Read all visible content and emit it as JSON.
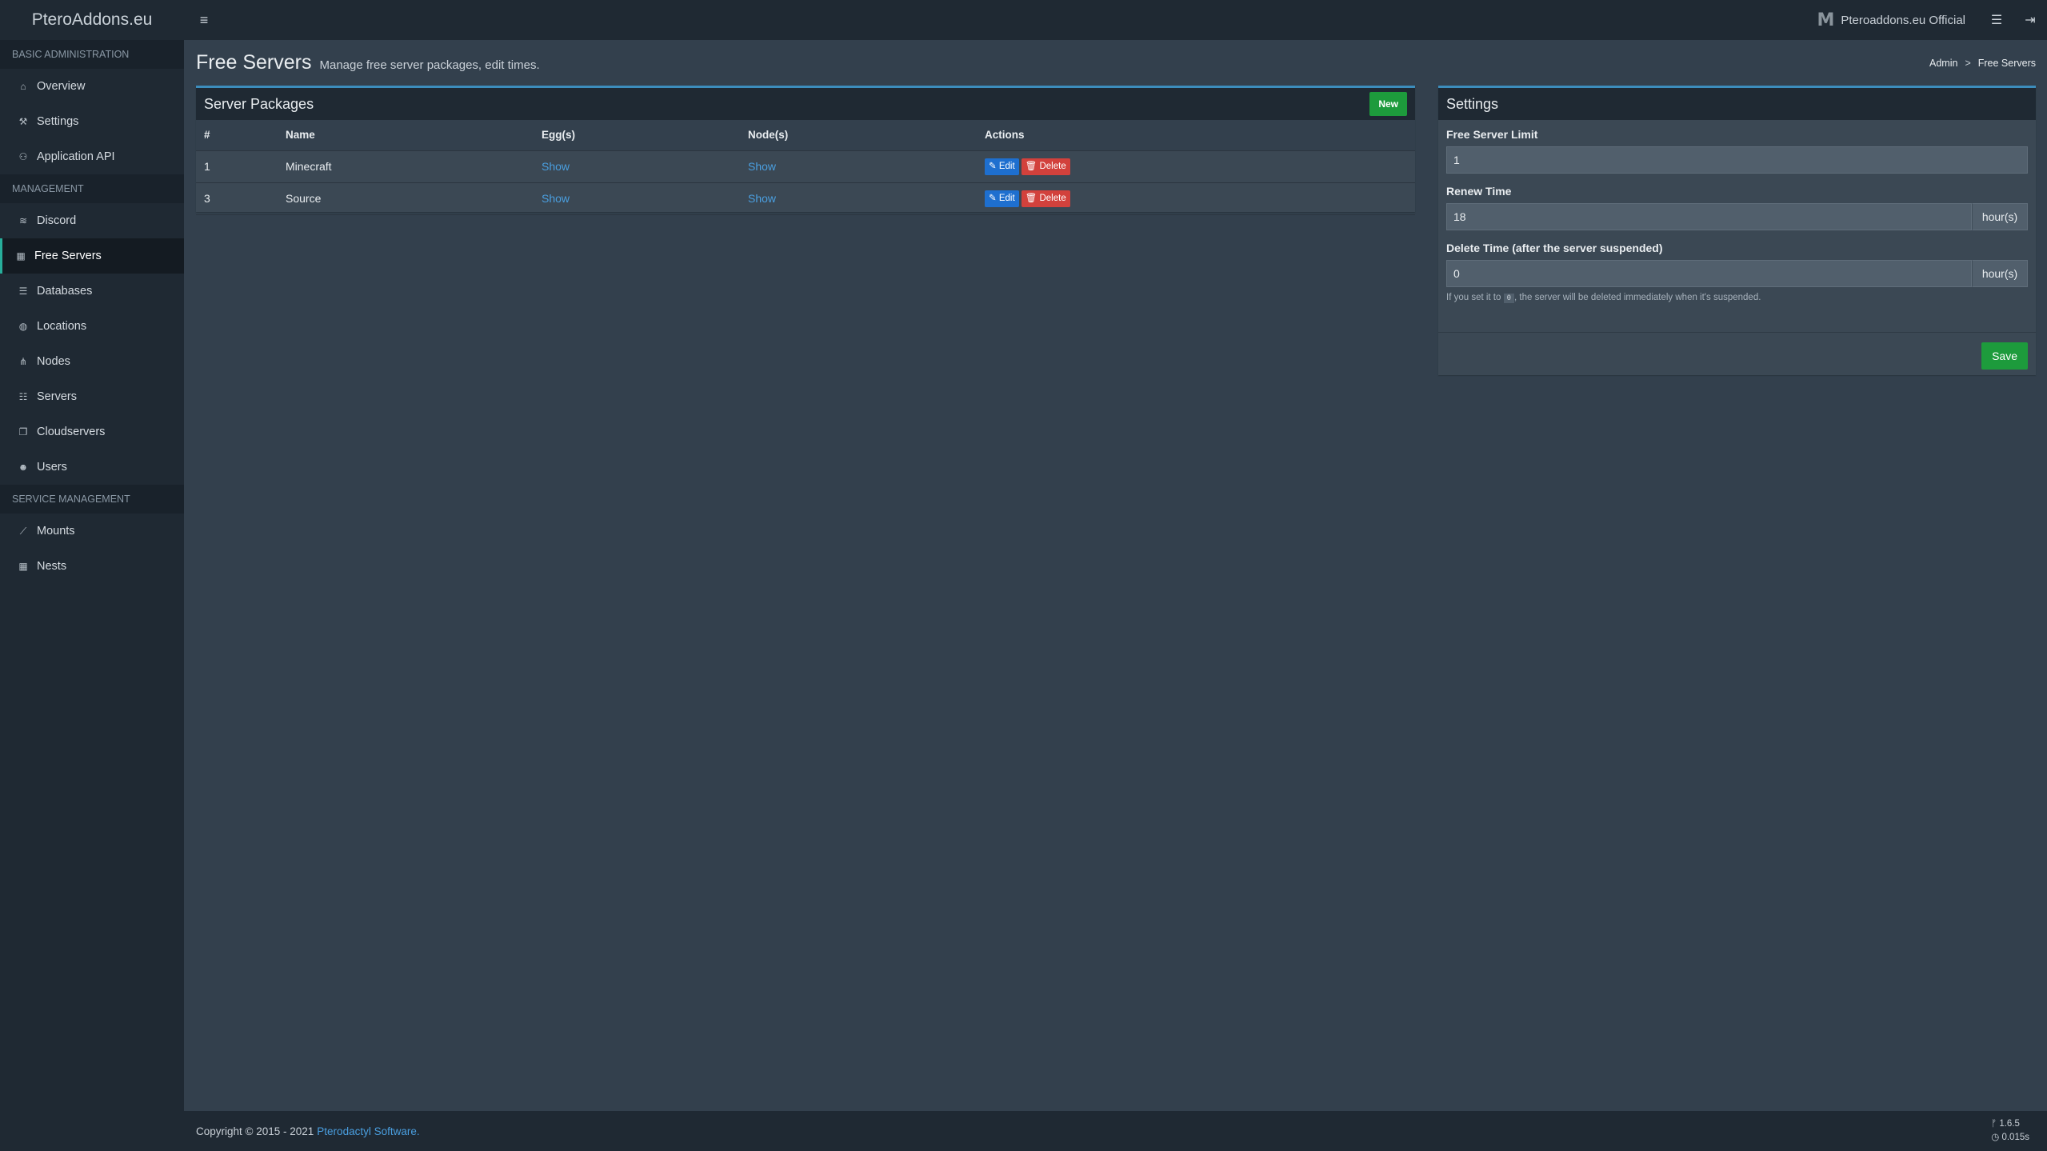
{
  "brand": "PteroAddons.eu",
  "topbar": {
    "user_name": "Pteroaddons.eu Official",
    "user_logo": "M"
  },
  "sidebar": {
    "sections": [
      {
        "title": "BASIC ADMINISTRATION",
        "items": [
          {
            "label": "Overview",
            "icon": "home-icon"
          },
          {
            "label": "Settings",
            "icon": "wrench-icon"
          },
          {
            "label": "Application API",
            "icon": "gamepad-icon"
          }
        ]
      },
      {
        "title": "MANAGEMENT",
        "items": [
          {
            "label": "Discord",
            "icon": "wifi-icon"
          },
          {
            "label": "Free Servers",
            "icon": "calendar-icon",
            "active": true
          },
          {
            "label": "Databases",
            "icon": "database-icon"
          },
          {
            "label": "Locations",
            "icon": "globe-icon"
          },
          {
            "label": "Nodes",
            "icon": "sitemap-icon"
          },
          {
            "label": "Servers",
            "icon": "list-icon"
          },
          {
            "label": "Cloudservers",
            "icon": "copy-icon"
          },
          {
            "label": "Users",
            "icon": "users-icon"
          }
        ]
      },
      {
        "title": "SERVICE MANAGEMENT",
        "items": [
          {
            "label": "Mounts",
            "icon": "magic-icon"
          },
          {
            "label": "Nests",
            "icon": "th-large-icon"
          }
        ]
      }
    ]
  },
  "page": {
    "title": "Free Servers",
    "subtitle": "Manage free server packages, edit times.",
    "breadcrumb": [
      "Admin",
      "Free Servers"
    ]
  },
  "packages": {
    "title": "Server Packages",
    "new_label": "New",
    "columns": [
      "#",
      "Name",
      "Egg(s)",
      "Node(s)",
      "Actions"
    ],
    "rows": [
      {
        "id": "1",
        "name": "Minecraft",
        "eggs": "Show",
        "nodes": "Show",
        "edit": "Edit",
        "delete": "Delete"
      },
      {
        "id": "3",
        "name": "Source",
        "eggs": "Show",
        "nodes": "Show",
        "edit": "Edit",
        "delete": "Delete"
      }
    ]
  },
  "settings": {
    "title": "Settings",
    "limit_label": "Free Server Limit",
    "limit_value": "1",
    "renew_label": "Renew Time",
    "renew_value": "18",
    "renew_unit": "hour(s)",
    "delete_label": "Delete Time (after the server suspended)",
    "delete_value": "0",
    "delete_unit": "hour(s)",
    "help_prefix": "If you set it to",
    "help_code": "0",
    "help_suffix": ", the server will be deleted immediately when it's suspended.",
    "save_label": "Save"
  },
  "footer": {
    "copyright": "Copyright © 2015 - 2021",
    "link": "Pterodactyl Software.",
    "version": "1.6.5",
    "time": "0.015s"
  },
  "colors": {
    "accent": "#3c8dbc",
    "success": "#1d9b3c",
    "danger": "#d2413c",
    "primary": "#1e6fcf",
    "active_border": "#27ae9b"
  }
}
